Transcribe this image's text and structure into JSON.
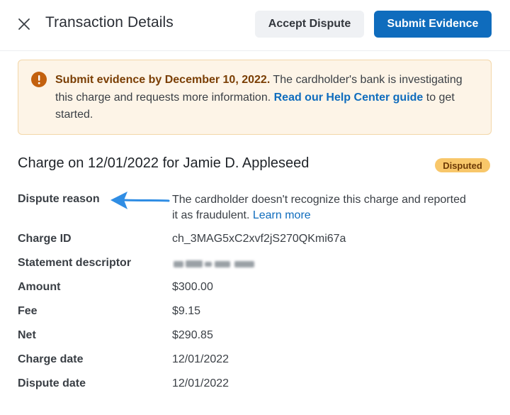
{
  "header": {
    "title": "Transaction Details",
    "accept_label": "Accept Dispute",
    "submit_label": "Submit Evidence",
    "close_icon": "close-icon"
  },
  "banner": {
    "icon": "warning-icon",
    "strong_text": "Submit evidence by December 10, 2022.",
    "body_text": " The cardholder's bank is investigating this charge and requests more information. ",
    "link_text": "Read our Help Center guide",
    "tail_text": " to get started.",
    "colors": {
      "background": "#fdf4e7",
      "border": "#f3d7a8",
      "icon": "#c3610f",
      "link": "#0f6cbd"
    }
  },
  "charge": {
    "title": "Charge on 12/01/2022 for Jamie D. Appleseed",
    "status_badge": "Disputed"
  },
  "details": {
    "dispute_reason_label": "Dispute reason",
    "dispute_reason_text": "The cardholder doesn't recognize this charge and reported it as fraudulent. ",
    "dispute_reason_link": "Learn more",
    "charge_id_label": "Charge ID",
    "charge_id_value": "ch_3MAG5xC2xvf2jS270QKmi67a",
    "statement_descriptor_label": "Statement descriptor",
    "amount_label": "Amount",
    "amount_value": "$300.00",
    "fee_label": "Fee",
    "fee_value": "$9.15",
    "net_label": "Net",
    "net_value": "$290.85",
    "charge_date_label": "Charge date",
    "charge_date_value": "12/01/2022",
    "dispute_date_label": "Dispute date",
    "dispute_date_value": "12/01/2022"
  },
  "annotation": {
    "arrow_icon": "left-arrow-icon",
    "arrow_color": "#2f8de4"
  }
}
